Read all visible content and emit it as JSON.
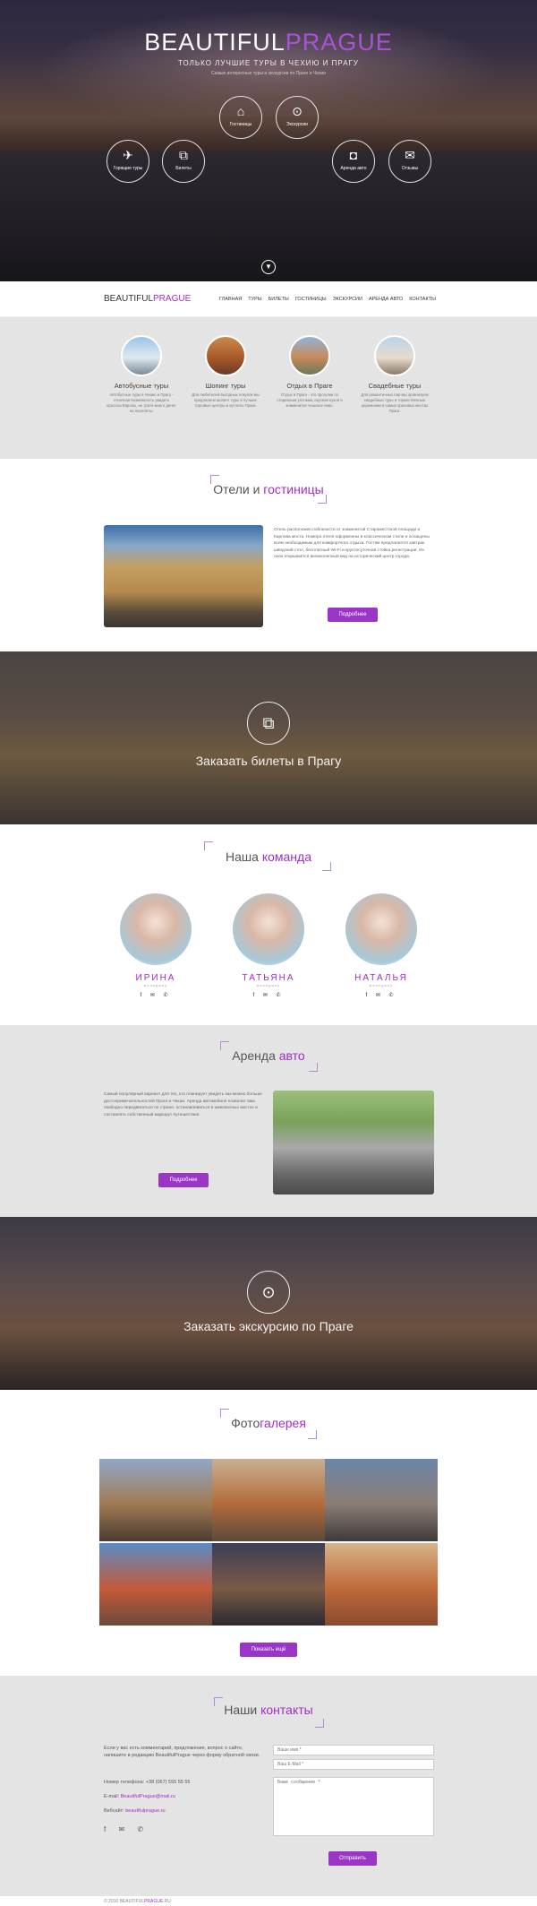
{
  "hero": {
    "title_a": "BEAUTIFUL",
    "title_b": "PRAGUE",
    "subtitle": "ТОЛЬКО ЛУЧШИЕ ТУРЫ В ЧЕХИЮ И ПРАГУ",
    "tagline": "Самые интересные туры и экскурсии по Праге и Чехии",
    "circles": [
      {
        "icon": "home-icon",
        "glyph": "⌂",
        "label": "Гостиницы"
      },
      {
        "icon": "map-pin-icon",
        "glyph": "⊙",
        "label": "Экскурсии"
      },
      {
        "icon": "plane-icon",
        "glyph": "✈",
        "label": "Горящие туры"
      },
      {
        "icon": "ticket-icon",
        "glyph": "⧉",
        "label": "Билеты"
      },
      {
        "icon": "car-icon",
        "glyph": "◘",
        "label": "Аренда авто"
      },
      {
        "icon": "chat-icon",
        "glyph": "✉",
        "label": "Отзывы"
      }
    ]
  },
  "nav": {
    "logo_a": "BEAUTIFUL",
    "logo_b": "PRAGUE",
    "items": [
      "ГЛАВНАЯ",
      "ТУРЫ",
      "БИЛЕТЫ",
      "ГОСТИНИЦЫ",
      "ЭКСКУРСИИ",
      "АРЕНДА АВТО",
      "КОНТАКТЫ"
    ]
  },
  "services": [
    {
      "title": "Автобусные туры",
      "text": "Автобусные туры в Чехию и Прагу - отличная возможность увидеть красоты Европы, не тратя много денег на перелёты."
    },
    {
      "title": "Шопинг туры",
      "text": "Для любителей выгодных покупок мы предлагаем шопинг туры в лучшие торговые центры и аутлеты Праги."
    },
    {
      "title": "Отдых в Праге",
      "text": "Отдых в Праге - это прогулки по старинным улочкам, вкусная кухня и знаменитое чешское пиво."
    },
    {
      "title": "Свадебные туры",
      "text": "Для романтичных пар мы организуем свадебные туры и торжественные церемонии в самых красивых местах Праги."
    }
  ],
  "hotels": {
    "title_a": "Отели и ",
    "title_b": "гостиницы",
    "text": "Отель расположен поблизости от знаменитой Староместской площади и Карлова моста. Номера отеля оформлены в классическом стиле и оснащены всем необходимым для комфортного отдыха. Гостям предлагается завтрак шведский стол, бесплатный Wi-Fi и круглосуточная стойка регистрации. Из окон открывается великолепный вид на исторический центр города.",
    "button": "Подробнее"
  },
  "tickets": {
    "icon": "ticket-icon",
    "glyph": "⧉",
    "caption": "Заказать билеты в Прагу"
  },
  "team": {
    "title_a": "Наша ",
    "title_b": "команда",
    "members": [
      {
        "name": "ИРИНА",
        "role": "менеджер"
      },
      {
        "name": "ТАТЬЯНА",
        "role": "менеджер"
      },
      {
        "name": "НАТАЛЬЯ",
        "role": "менеджер"
      }
    ],
    "social": "f ✉ ✆"
  },
  "auto": {
    "title_a": "Аренда ",
    "title_b": "авто",
    "text": "Самый популярный вариант для тех, кто планирует увидеть как можно больше достопримечательностей Праги и Чехии. Аренда автомобиля позволит вам свободно передвигаться по стране, останавливаться в живописных местах и составлять собственный маршрут путешествия.",
    "button": "Подробнее"
  },
  "excursion": {
    "icon": "map-pin-icon",
    "glyph": "⊙",
    "caption": "Заказать экскурсию по Праге"
  },
  "gallery": {
    "title_a": "Фото",
    "title_b": "галерея",
    "button": "Показать ещё",
    "images": [
      {
        "c1": "#8fa8c8",
        "c2": "#a07a52",
        "c3": "#4b3b30"
      },
      {
        "c1": "#c7b092",
        "c2": "#b36b3a",
        "c3": "#5c4a3a"
      },
      {
        "c1": "#6b86a8",
        "c2": "#8a7e74",
        "c3": "#3f3a3a"
      },
      {
        "c1": "#5a8bc6",
        "c2": "#c45a3a",
        "c3": "#6a4a3a"
      },
      {
        "c1": "#3d3e56",
        "c2": "#7a5a46",
        "c3": "#2b2a30"
      },
      {
        "c1": "#d6b48a",
        "c2": "#c06a3a",
        "c3": "#8a4a30"
      }
    ]
  },
  "contacts": {
    "title_a": "Наши ",
    "title_b": "контакты",
    "intro": "Если у вас есть комментарий, предложение, вопрос о сайте, напишите в редакцию BeautifulPrague через форму обратной связи.",
    "phone_label": "Номер телефона: ",
    "phone": "+38 (067) 555 55 55",
    "email_label": "E-mail: ",
    "email": "BeautifulPrague@mail.ru",
    "web_label": "Вебсайт: ",
    "web": "beautifulprague.ru",
    "social": "f ✉ ✆",
    "name_placeholder": "Ваше имя *",
    "email_placeholder": "Ваш E-Mail *",
    "message_placeholder": "Ваше сообщение *",
    "submit": "Отправить"
  },
  "footer": {
    "text_a": "© 2016 BEAUTIFUL",
    "text_b": "PRAGUE",
    "text_c": ".RU"
  }
}
